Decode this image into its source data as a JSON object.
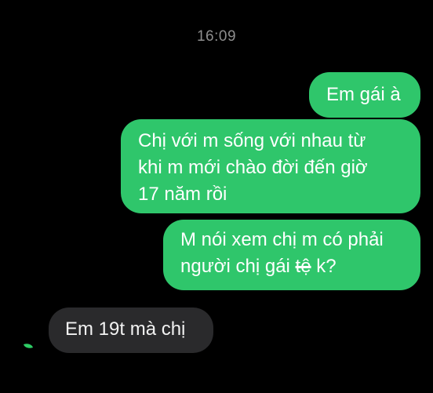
{
  "timestamp": "16:09",
  "messages": [
    {
      "direction": "sent",
      "lines": [
        "Em gái à"
      ]
    },
    {
      "direction": "sent",
      "lines": [
        "Chị với m sống với nhau từ",
        "khi m mới chào đời đến giờ",
        "17 năm rồi"
      ]
    },
    {
      "direction": "sent",
      "line1": "M nói xem chị m có phải",
      "line2_before": "người chị gái ",
      "line2_struck": "tệ",
      "line2_after": " k?"
    },
    {
      "direction": "received",
      "lines": [
        "Em 19t mà chị"
      ]
    }
  ],
  "colors": {
    "background": "#000000",
    "sent_bubble": "#2fc66b",
    "received_bubble": "#2a2a2c",
    "timestamp": "#8e8e8e"
  },
  "icons": {
    "received_marker": "leaf-icon"
  }
}
